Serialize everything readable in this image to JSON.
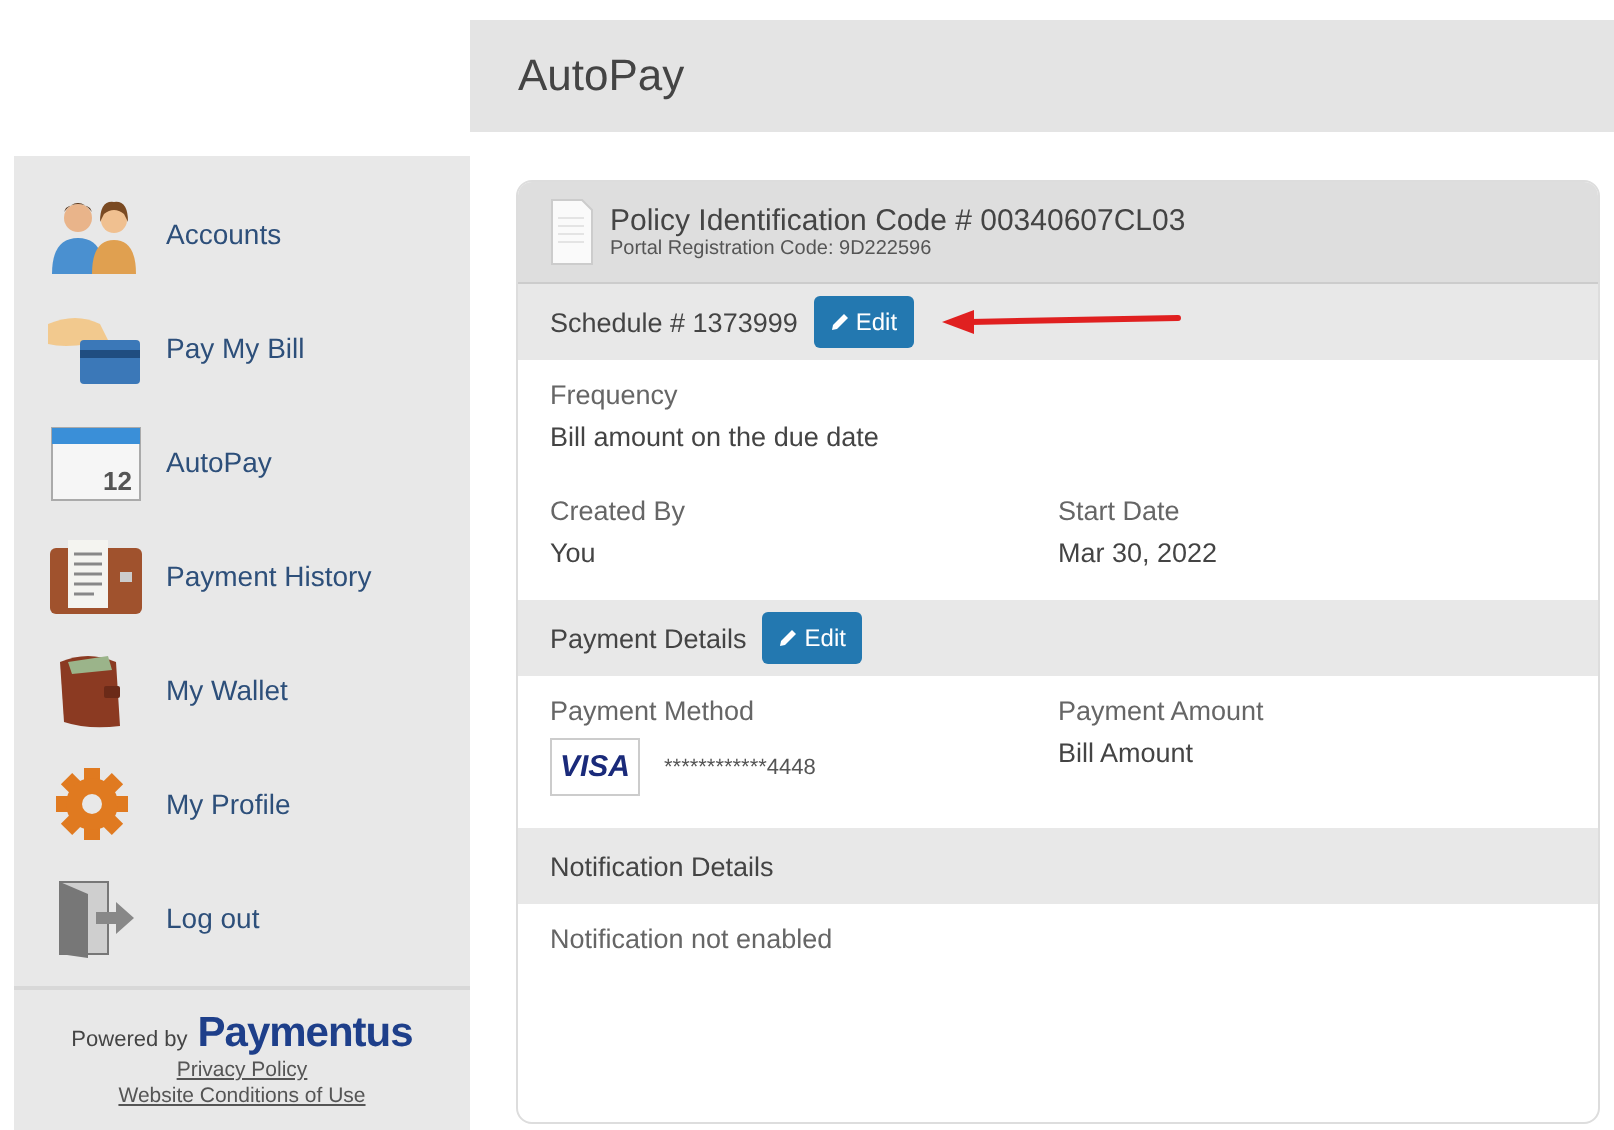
{
  "header": {
    "title": "AutoPay"
  },
  "sidebar": {
    "items": [
      {
        "label": "Accounts",
        "kind": "people"
      },
      {
        "label": "Pay My Bill",
        "kind": "card"
      },
      {
        "label": "AutoPay",
        "kind": "calendar",
        "icon_number": "12"
      },
      {
        "label": "Payment History",
        "kind": "ledger"
      },
      {
        "label": "My Wallet",
        "kind": "wallet"
      },
      {
        "label": "My Profile",
        "kind": "gear"
      },
      {
        "label": "Log out",
        "kind": "door"
      }
    ],
    "footer": {
      "powered_by": "Powered by",
      "brand": "Paymentus",
      "links": [
        "Privacy Policy",
        "Website Conditions of Use"
      ]
    }
  },
  "card": {
    "title": "Policy Identification Code # 00340607CL03",
    "subtitle": "Portal Registration Code: 9D222596",
    "sections": [
      {
        "heading": "Schedule # 1373999",
        "edit": "Edit",
        "annotated": true,
        "fields": [
          {
            "kind": "wide",
            "label": "Frequency",
            "value": "Bill amount on the due date"
          },
          {
            "kind": "half",
            "label": "Created By",
            "value": "You"
          },
          {
            "kind": "half",
            "label": "Start Date",
            "value": "Mar 30, 2022"
          }
        ]
      },
      {
        "heading": "Payment Details",
        "edit": "Edit",
        "annotated": false,
        "fields": [
          {
            "kind": "card",
            "label": "Payment Method",
            "card_brand": "VISA",
            "value": "************4448"
          },
          {
            "kind": "half",
            "label": "Payment Amount",
            "value": "Bill Amount"
          }
        ]
      },
      {
        "heading": "Notification Details",
        "fields": [
          {
            "kind": "note",
            "value": "Notification not enabled"
          }
        ]
      }
    ]
  }
}
